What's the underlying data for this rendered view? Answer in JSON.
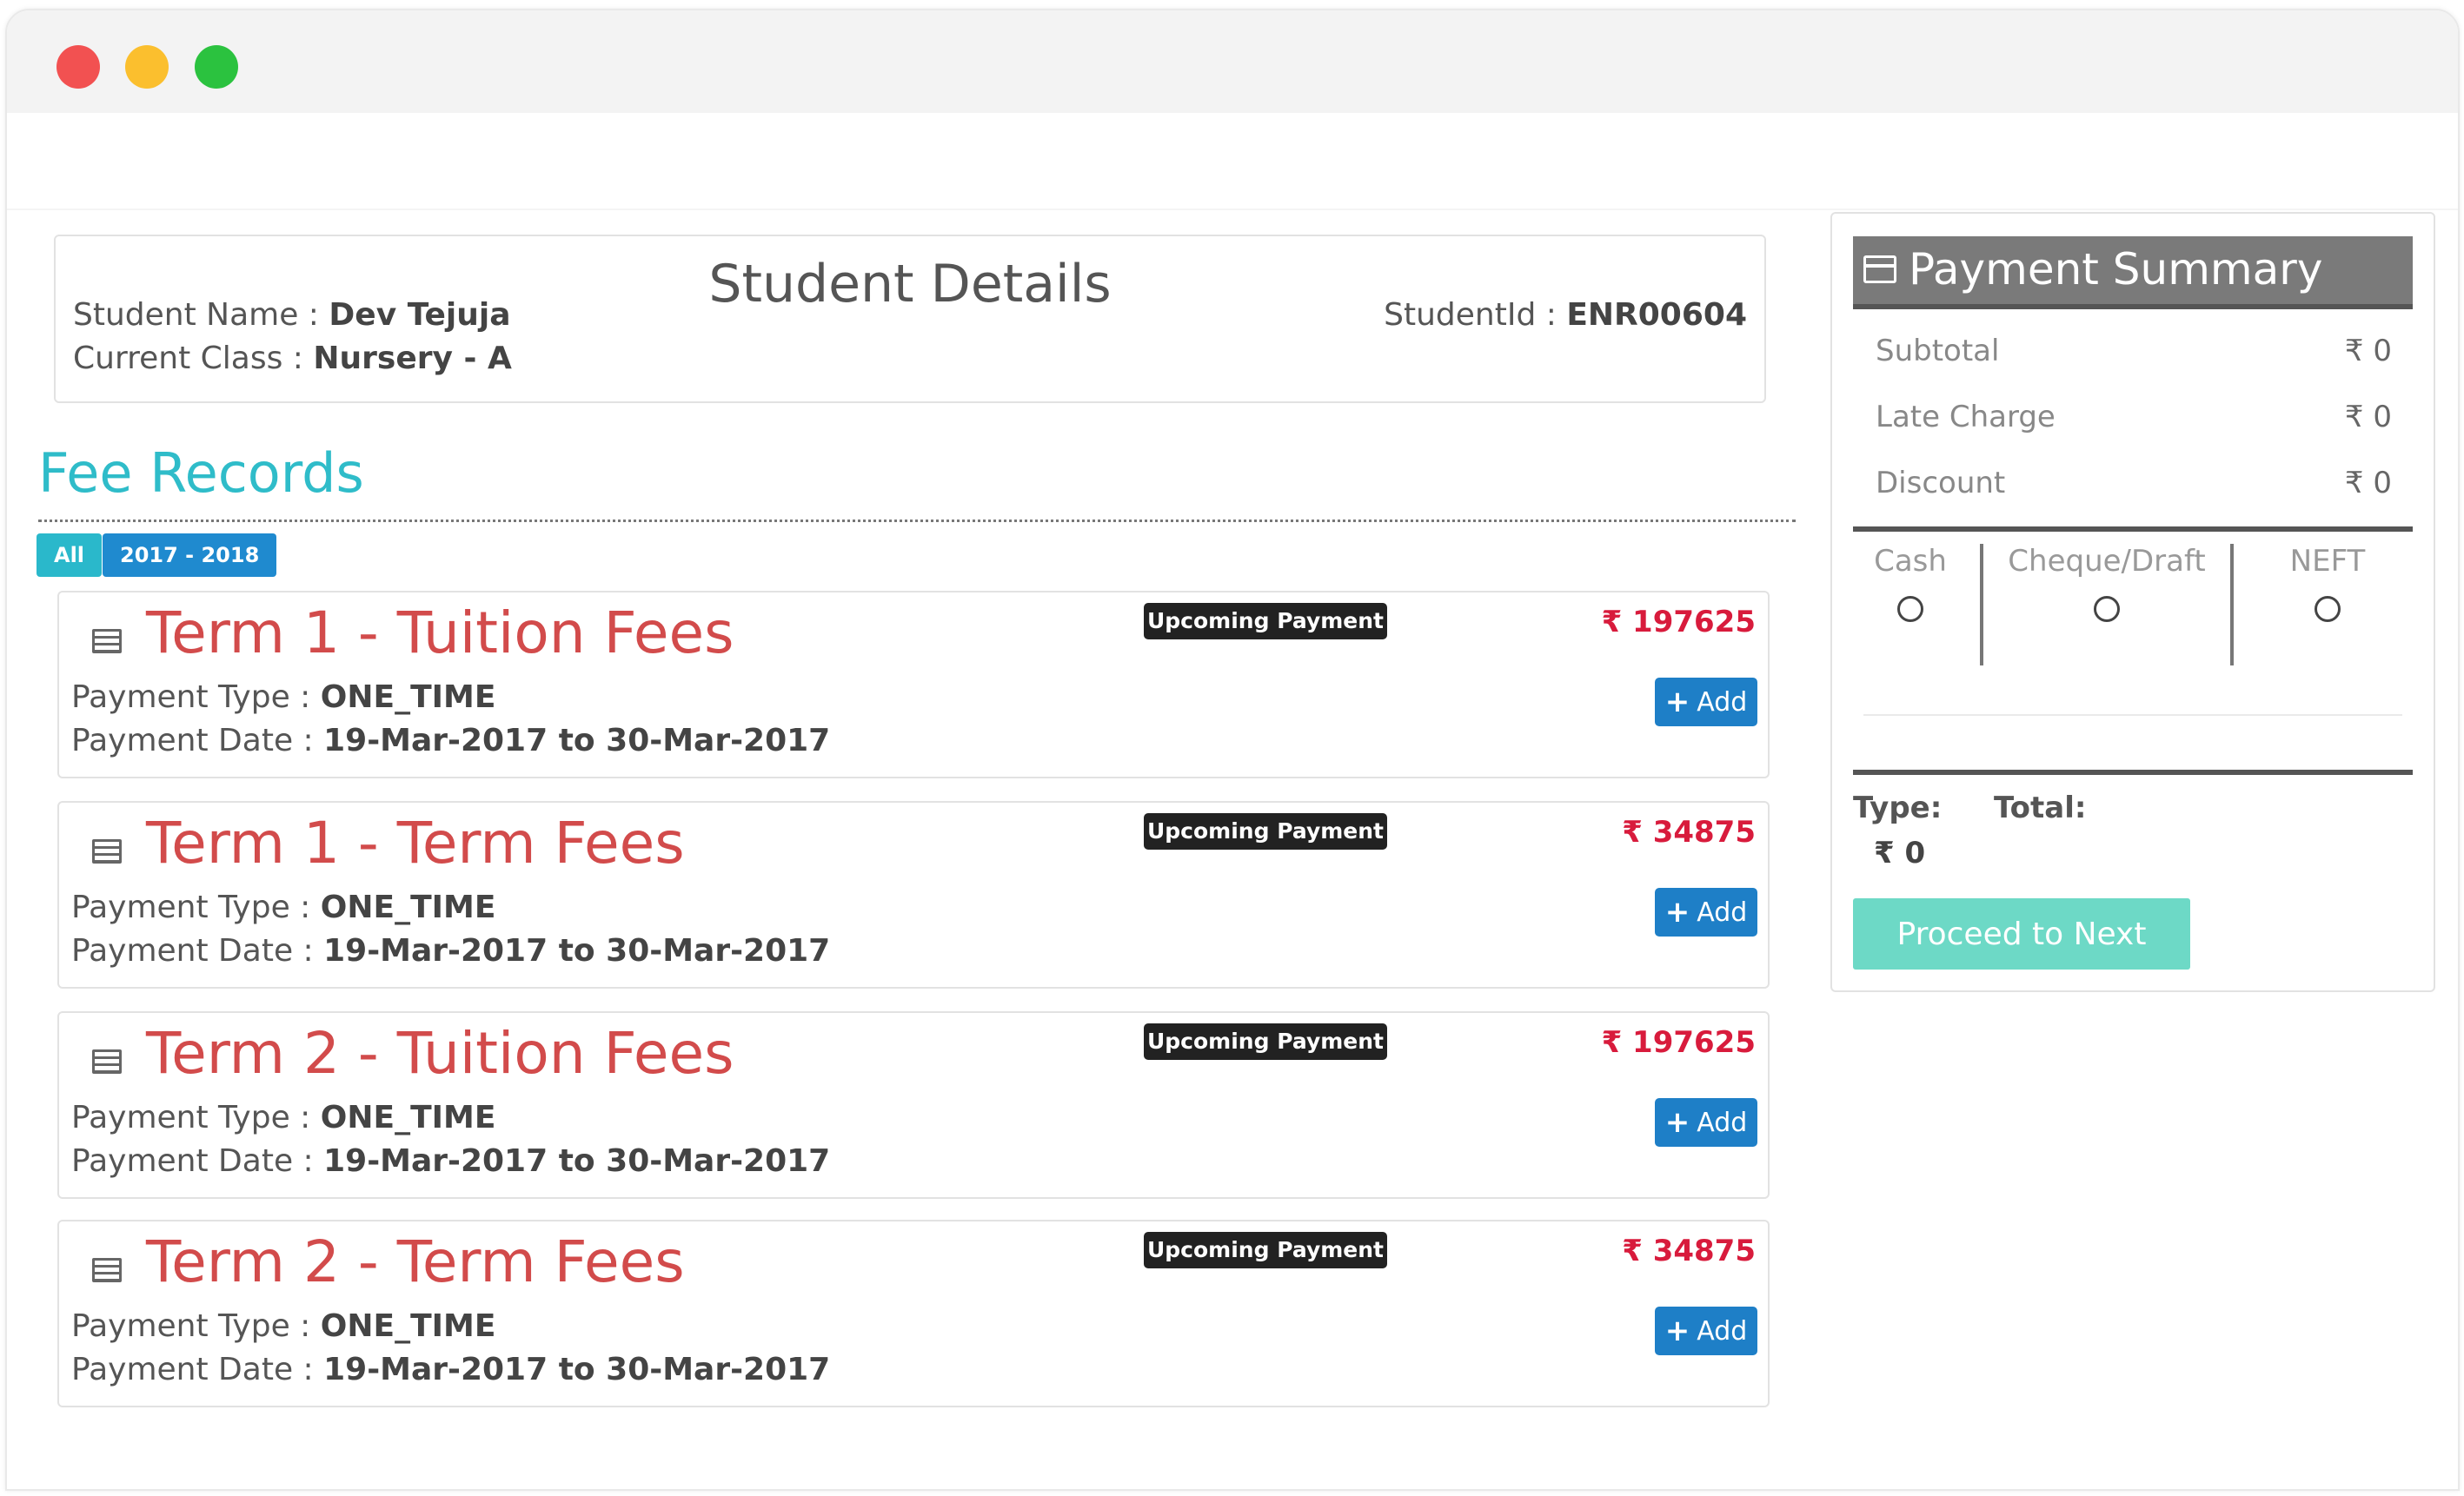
{
  "student": {
    "title": "Student Details",
    "name_label": "Student Name : ",
    "name_value": "Dev Tejuja",
    "class_label": "Current Class : ",
    "class_value": "Nursery - A",
    "id_label": "StudentId : ",
    "id_value": "ENR00604"
  },
  "fee_records": {
    "heading": "Fee Records",
    "filters": [
      "All",
      "2017 - 2018"
    ],
    "type_label": "Payment Type : ",
    "date_label": "Payment Date : ",
    "add_label": "Add",
    "items": [
      {
        "title": "Term 1 - Tuition Fees",
        "badge": "Upcoming Payment",
        "amount": "₹ 197625",
        "type": "ONE_TIME",
        "date": "19-Mar-2017 to 30-Mar-2017"
      },
      {
        "title": "Term 1 - Term Fees",
        "badge": "Upcoming Payment",
        "amount": "₹ 34875",
        "type": "ONE_TIME",
        "date": "19-Mar-2017 to 30-Mar-2017"
      },
      {
        "title": "Term 2 - Tuition Fees",
        "badge": "Upcoming Payment",
        "amount": "₹ 197625",
        "type": "ONE_TIME",
        "date": "19-Mar-2017 to 30-Mar-2017"
      },
      {
        "title": "Term 2 - Term Fees",
        "badge": "Upcoming Payment",
        "amount": "₹ 34875",
        "type": "ONE_TIME",
        "date": "19-Mar-2017 to 30-Mar-2017"
      }
    ]
  },
  "summary": {
    "title": "Payment Summary",
    "rows": [
      {
        "label": "Subtotal",
        "value": "₹ 0"
      },
      {
        "label": "Late Charge",
        "value": "₹ 0"
      },
      {
        "label": "Discount",
        "value": "₹ 0"
      }
    ],
    "methods": [
      "Cash",
      "Cheque/Draft",
      "NEFT"
    ],
    "type_label": "Type:",
    "total_label": "Total:",
    "total_value": "₹ 0",
    "proceed_label": "Proceed to Next"
  },
  "colors": {
    "accent_teal": "#2fbcc9",
    "fee_title_red": "#d24b4b",
    "amount_red": "#d81b3c",
    "add_blue": "#1e7fc7",
    "proceed_green": "#6dd9c6"
  }
}
